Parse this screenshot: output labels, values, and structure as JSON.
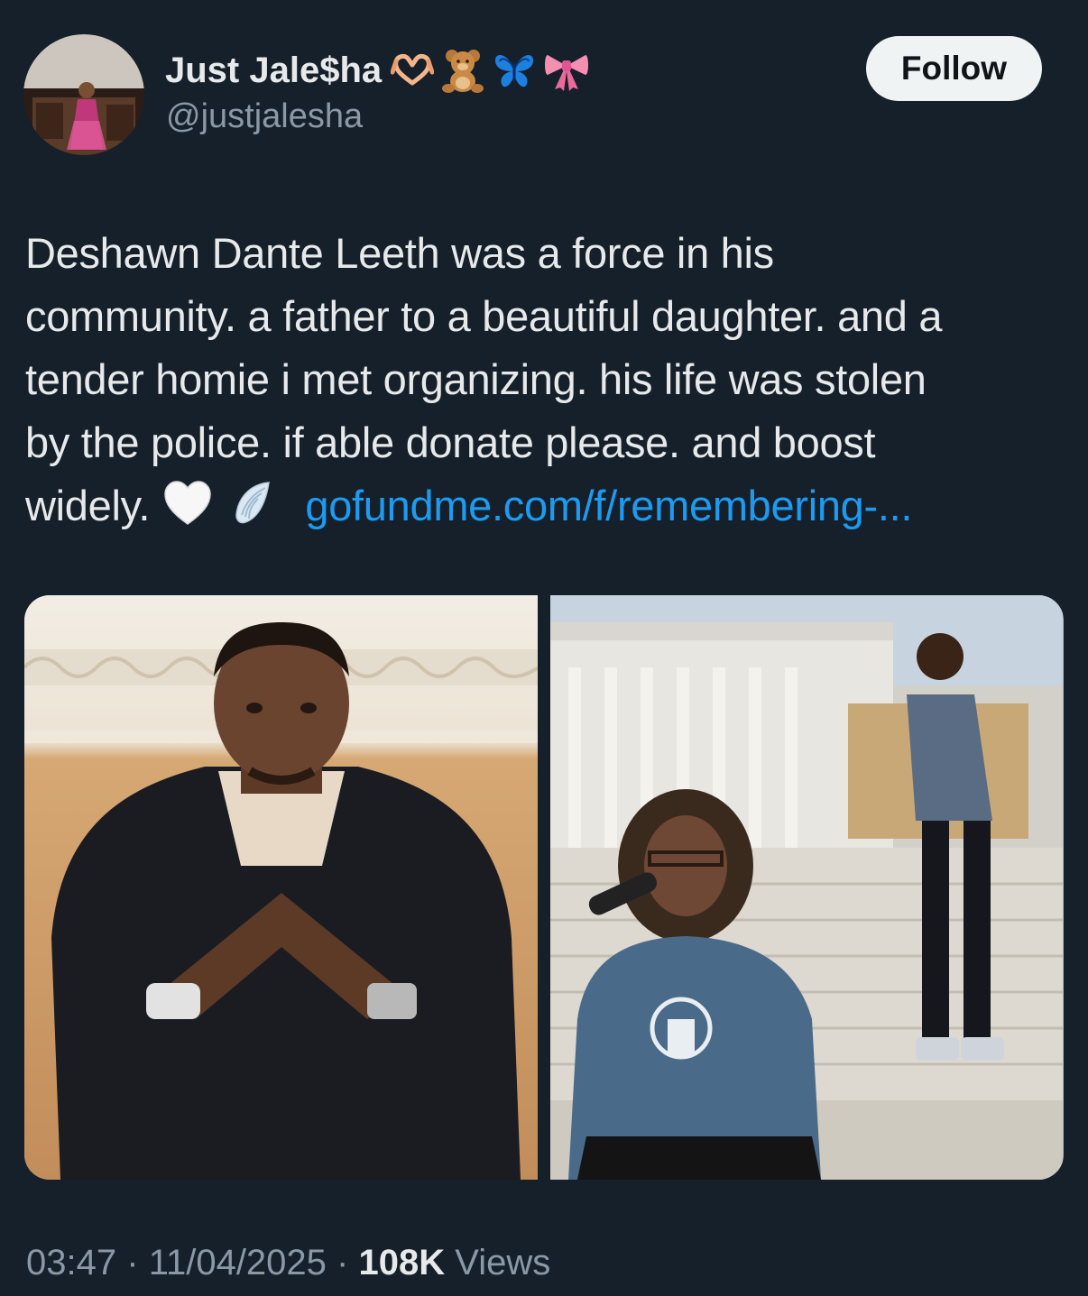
{
  "author": {
    "display_name": "Just Jale$ha",
    "handle": "@justjalesha",
    "name_emojis": [
      "heart-hands-icon",
      "teddy-bear-icon",
      "butterfly-icon",
      "ribbon-icon"
    ]
  },
  "follow_button": {
    "label": "Follow"
  },
  "tweet": {
    "lines": [
      "Deshawn Dante Leeth was a force in his",
      "community. a father to a beautiful daughter. and a",
      "tender homie i met organizing. his life was stolen",
      "by the police. if able donate please. and boost"
    ],
    "last_line_text": "widely.",
    "trailing_emojis": [
      "white-heart-icon",
      "wing-icon"
    ],
    "link_text": "gofundme.com/f/remembering-..."
  },
  "media": {
    "count": 2,
    "photos": [
      "portrait-photo",
      "rally-photo"
    ]
  },
  "meta": {
    "time": "03:47",
    "date": "11/04/2025",
    "views_count": "108K",
    "views_label": "Views",
    "separator": "·"
  },
  "colors": {
    "background": "#15202b",
    "text": "#e7e9ea",
    "muted": "#8b98a5",
    "link": "#1d9bf0",
    "button_bg": "#eff3f4"
  }
}
